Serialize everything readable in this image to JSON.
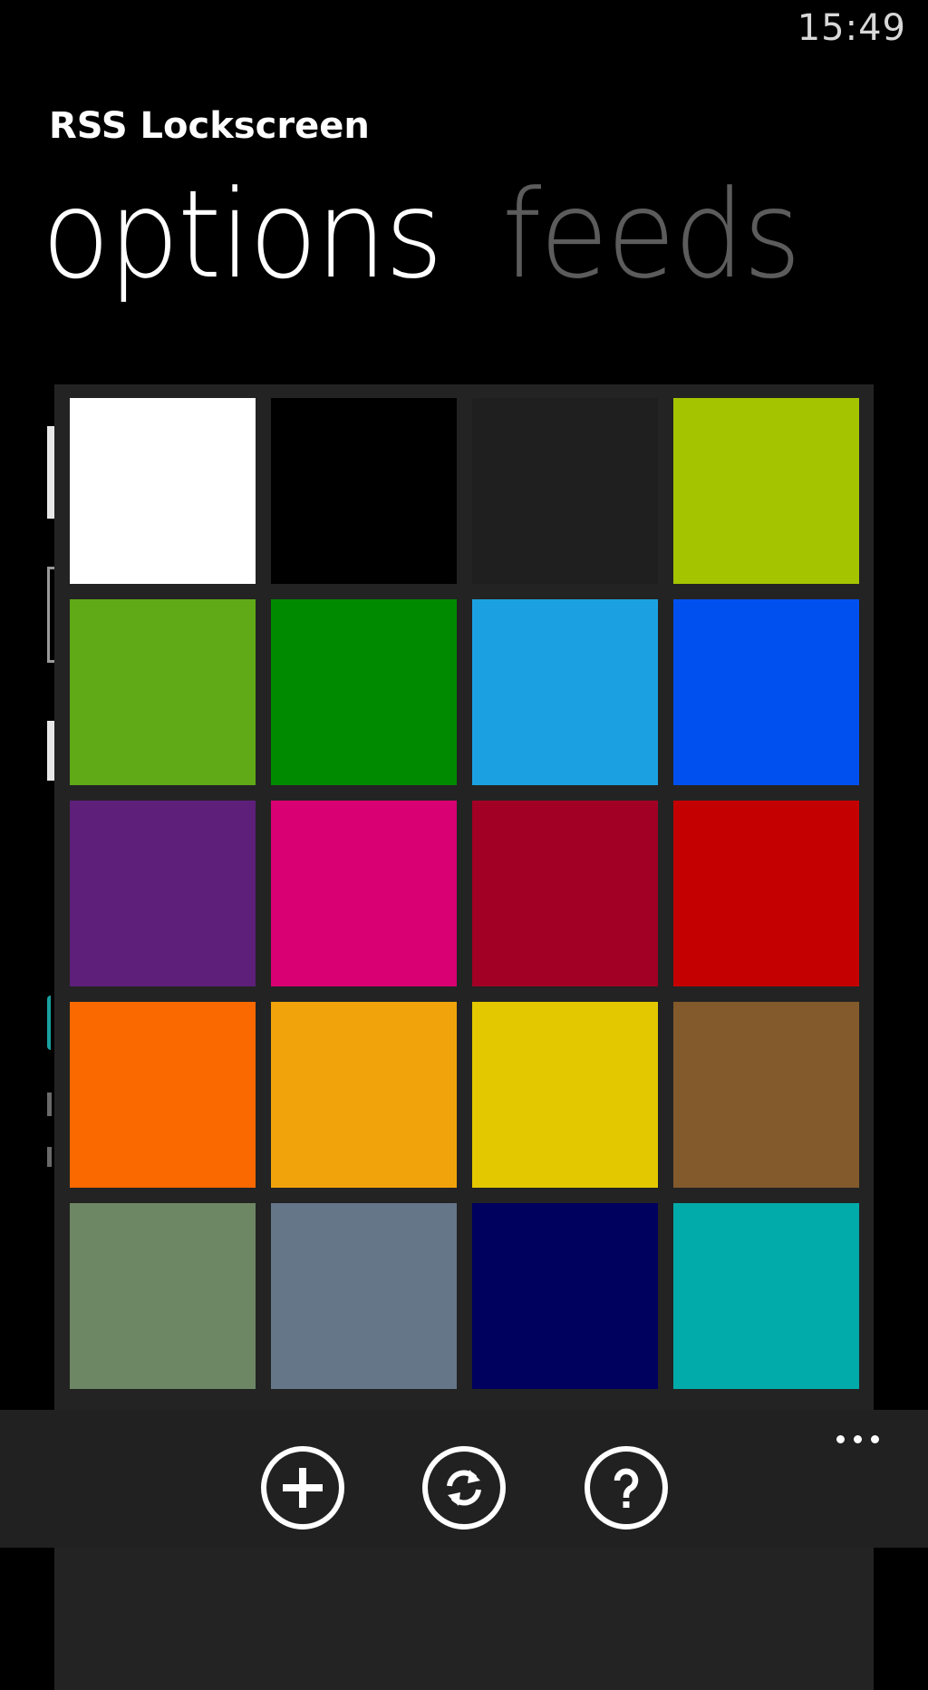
{
  "status_bar": {
    "time": "15:49"
  },
  "app": {
    "title": "RSS Lockscreen"
  },
  "pivot": {
    "tabs": [
      {
        "label": "options",
        "active": true
      },
      {
        "label": "feeds",
        "active": false
      }
    ]
  },
  "color_picker": {
    "swatches": [
      {
        "color": "#ffffff"
      },
      {
        "color": "#000000"
      },
      {
        "color": "#1f1f1f"
      },
      {
        "color": "#a4c400"
      },
      {
        "color": "#60a917"
      },
      {
        "color": "#008a00"
      },
      {
        "color": "#1ba1e2"
      },
      {
        "color": "#0050ef"
      },
      {
        "color": "#5d1f7a"
      },
      {
        "color": "#d80073"
      },
      {
        "color": "#a20025"
      },
      {
        "color": "#c40000"
      },
      {
        "color": "#fa6800"
      },
      {
        "color": "#f0a30a"
      },
      {
        "color": "#e3c800"
      },
      {
        "color": "#825a2c"
      },
      {
        "color": "#6d8764"
      },
      {
        "color": "#647687"
      },
      {
        "color": "#00005f"
      },
      {
        "color": "#00aba9"
      }
    ]
  },
  "app_bar": {
    "buttons": [
      {
        "icon": "add-icon"
      },
      {
        "icon": "sync-icon"
      },
      {
        "icon": "help-icon"
      }
    ],
    "more_icon": "ellipsis-icon"
  }
}
